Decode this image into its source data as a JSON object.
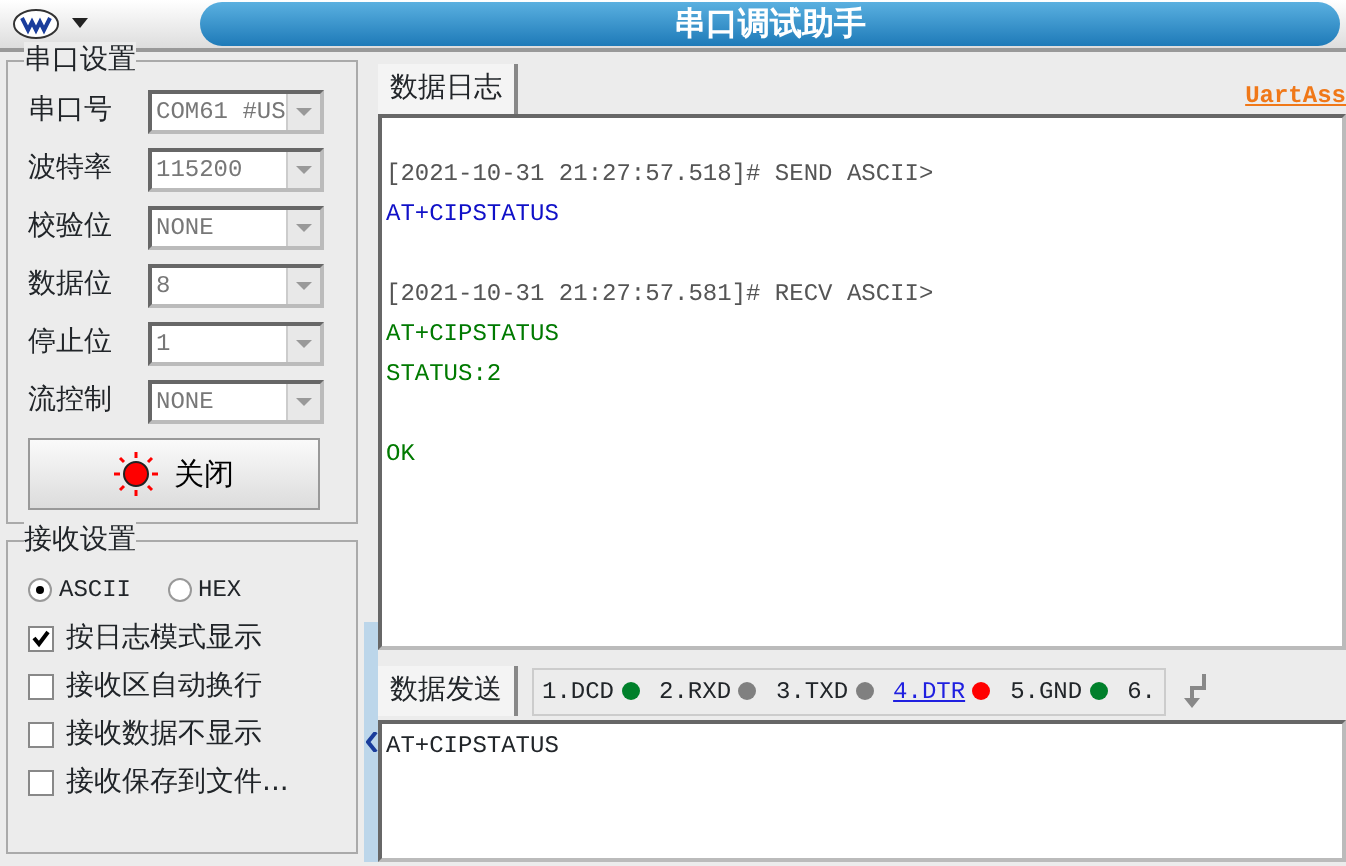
{
  "window": {
    "title": "串口调试助手",
    "link": "UartAss"
  },
  "serial_settings": {
    "legend": "串口设置",
    "fields": [
      {
        "label": "串口号",
        "value": "COM61 #US"
      },
      {
        "label": "波特率",
        "value": "115200"
      },
      {
        "label": "校验位",
        "value": "NONE"
      },
      {
        "label": "数据位",
        "value": "8"
      },
      {
        "label": "停止位",
        "value": "1"
      },
      {
        "label": "流控制",
        "value": "NONE"
      }
    ],
    "button": {
      "label": "关闭",
      "on": true
    }
  },
  "receive_settings": {
    "legend": "接收设置",
    "modes": [
      {
        "label": "ASCII",
        "selected": true
      },
      {
        "label": "HEX",
        "selected": false
      }
    ],
    "options": [
      {
        "label": "按日志模式显示",
        "checked": true
      },
      {
        "label": "接收区自动换行",
        "checked": false
      },
      {
        "label": "接收数据不显示",
        "checked": false
      },
      {
        "label": "接收保存到文件...",
        "checked": false
      }
    ]
  },
  "log_tab": {
    "label": "数据日志"
  },
  "log": [
    {
      "kind": "header",
      "text": "[2021-10-31 21:27:57.518]# SEND ASCII>"
    },
    {
      "kind": "sent",
      "text": "AT+CIPSTATUS"
    },
    {
      "kind": "header",
      "text": "[2021-10-31 21:27:57.581]# RECV ASCII>"
    },
    {
      "kind": "received",
      "text": "AT+CIPSTATUS"
    },
    {
      "kind": "received",
      "text": "STATUS:2"
    },
    {
      "kind": "gap",
      "text": "OK"
    }
  ],
  "send_tab": {
    "label": "数据发送"
  },
  "pins": [
    {
      "label": "1.DCD",
      "color": "#00802b",
      "link": false
    },
    {
      "label": "2.RXD",
      "color": "#808080",
      "link": false
    },
    {
      "label": "3.TXD",
      "color": "#808080",
      "link": false
    },
    {
      "label": "4.DTR",
      "color": "#ff0000",
      "link": true
    },
    {
      "label": "5.GND",
      "color": "#00802b",
      "link": false
    },
    {
      "label": "6.",
      "link": false
    }
  ],
  "send_text": "AT+CIPSTATUS"
}
